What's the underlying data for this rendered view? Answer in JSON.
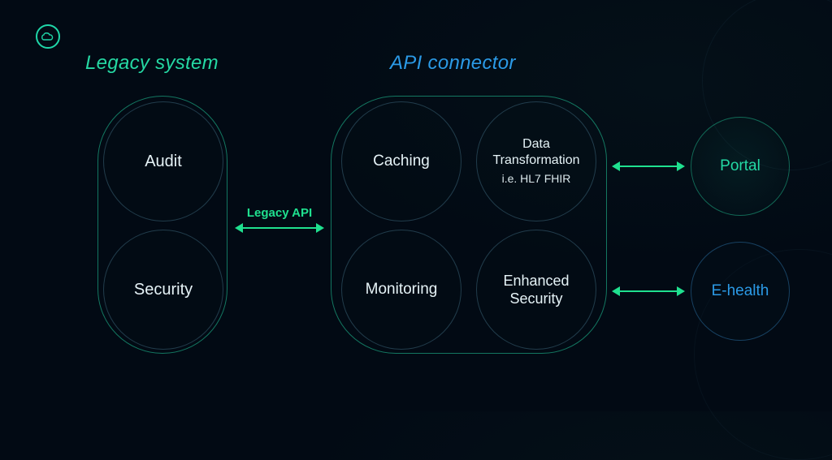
{
  "titles": {
    "legacy": "Legacy system",
    "api": "API connector"
  },
  "legacy_group": {
    "items": [
      "Audit",
      "Security"
    ]
  },
  "api_group": {
    "items": [
      {
        "label": "Caching"
      },
      {
        "label": "Data Transformation",
        "sub": "i.e. HL7 FHIR"
      },
      {
        "label": "Monitoring"
      },
      {
        "label": "Enhanced Security"
      }
    ]
  },
  "connectors": {
    "legacy_api_label": "Legacy API"
  },
  "targets": {
    "portal": "Portal",
    "ehealth": "E-health"
  },
  "colors": {
    "green": "#1fe08f",
    "teal": "#25d8a3",
    "blue": "#2b9ae6",
    "bg": "#020a14"
  }
}
